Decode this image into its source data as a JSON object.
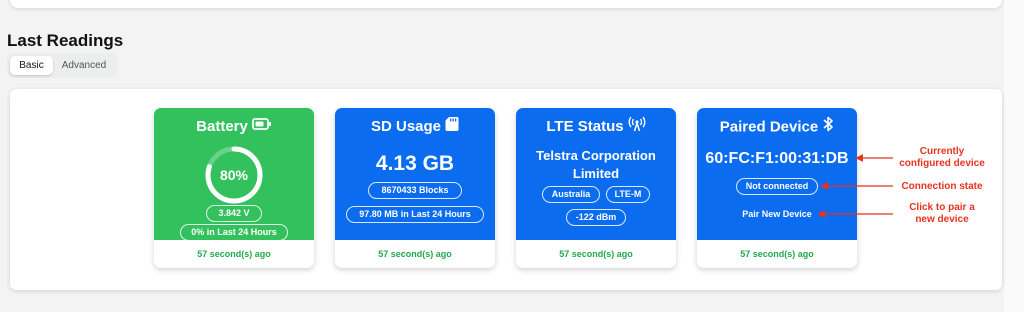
{
  "section": {
    "title": "Last Readings"
  },
  "tabs": [
    {
      "label": "Basic",
      "active": true
    },
    {
      "label": "Advanced",
      "active": false
    }
  ],
  "colors": {
    "battery_card": "#33c15e",
    "info_card": "#0b6cf0",
    "footer_text": "#22a94f",
    "annotation": "#e8321f"
  },
  "cards": {
    "battery": {
      "title": "Battery",
      "icon": "battery-icon",
      "percent_label": "80%",
      "level_fraction": 0.8,
      "voltage": "3.842 V",
      "change": "0% in Last 24 Hours",
      "updated": "57 second(s) ago"
    },
    "sd": {
      "title": "SD Usage",
      "icon": "sd-card-icon",
      "size": "4.13 GB",
      "blocks": "8670433 Blocks",
      "change": "97.80 MB in Last 24 Hours",
      "updated": "57 second(s) ago"
    },
    "lte": {
      "title": "LTE Status",
      "icon": "antenna-signal-icon",
      "carrier_line1": "Telstra Corporation",
      "carrier_line2": "Limited",
      "country": "Australia",
      "network": "LTE-M",
      "signal": "-122 dBm",
      "updated": "57 second(s) ago"
    },
    "paired": {
      "title": "Paired Device",
      "icon": "bluetooth-icon",
      "mac": "60:FC:F1:00:31:DB",
      "state": "Not connected",
      "action": "Pair New Device",
      "updated": "57 second(s) ago"
    }
  },
  "annotations": {
    "configured_line1": "Currently",
    "configured_line2": "configured device",
    "connection": "Connection state",
    "pair_line1": "Click to pair a",
    "pair_line2": "new device"
  }
}
